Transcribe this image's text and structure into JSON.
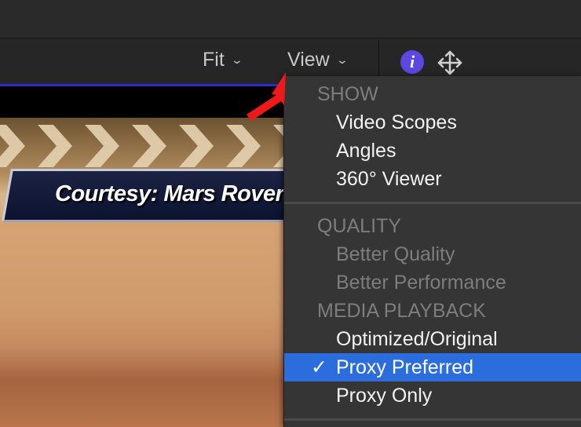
{
  "toolbar": {
    "fit_label": "Fit",
    "view_label": "View",
    "chevron": "⌄"
  },
  "icons": {
    "info": "info-icon",
    "transform": "transform-icon",
    "info_glyph": "i",
    "accent": "#5a48e0"
  },
  "viewer": {
    "banner_text": "Courtesy: Mars Rover"
  },
  "menu": {
    "sections": [
      {
        "header": "SHOW",
        "items": [
          {
            "label": "Video Scopes"
          },
          {
            "label": "Angles"
          },
          {
            "label": "360° Viewer"
          }
        ]
      },
      {
        "header": "QUALITY",
        "items": [
          {
            "label": "Better Quality",
            "disabled": true
          },
          {
            "label": "Better Performance",
            "disabled": true
          }
        ]
      },
      {
        "header": "MEDIA PLAYBACK",
        "items": [
          {
            "label": "Optimized/Original"
          },
          {
            "label": "Proxy Preferred",
            "checked": true,
            "check_mark": "✓"
          },
          {
            "label": "Proxy Only"
          }
        ]
      }
    ],
    "selection_color": "#2c6ddd"
  }
}
